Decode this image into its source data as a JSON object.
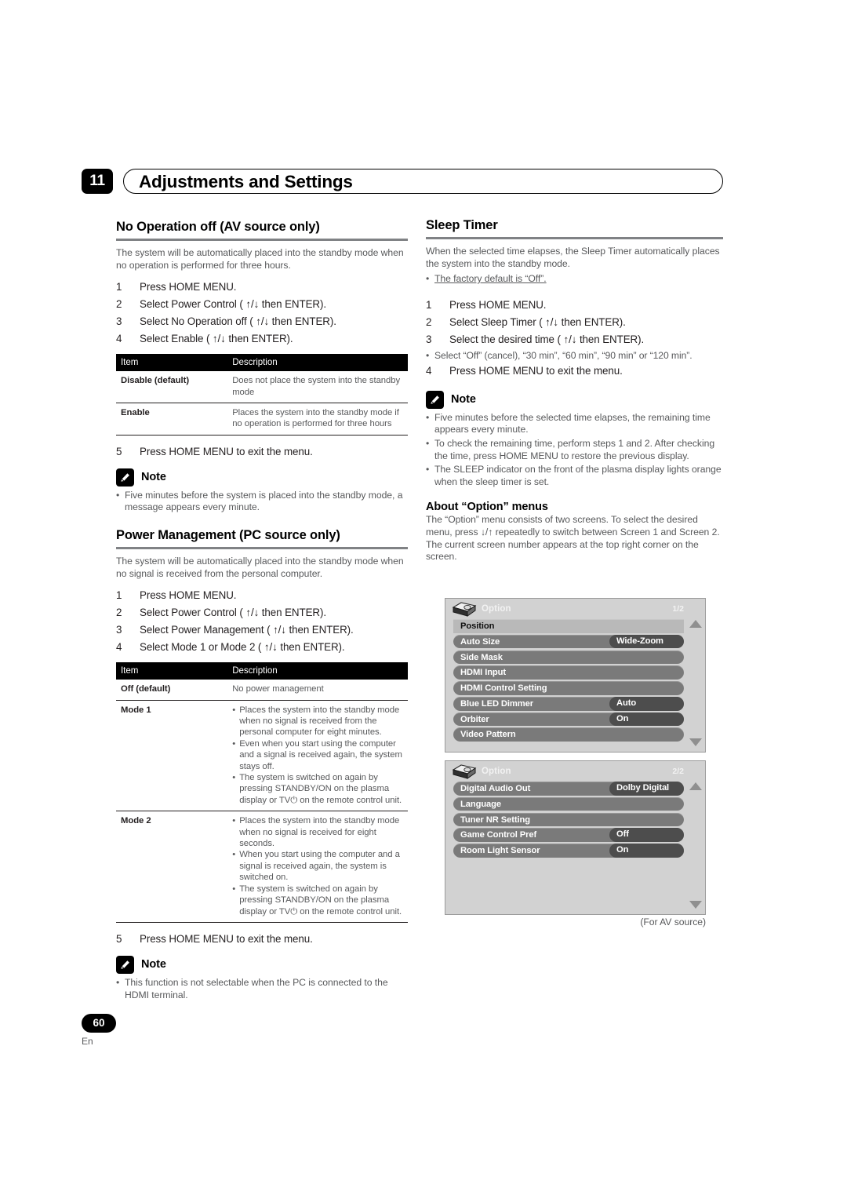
{
  "header": {
    "chapter_number": "11",
    "chapter_title": "Adjustments and Settings"
  },
  "left_column": {
    "section1": {
      "heading": "No Operation off (AV source only)",
      "intro": "The system will be automatically placed into the standby mode when no operation is performed for three hours.",
      "steps": [
        {
          "num": "1",
          "text": "Press HOME MENU."
        },
        {
          "num": "2",
          "text": "Select  Power Control  ( ↑/↓ then ENTER)."
        },
        {
          "num": "3",
          "text": "Select  No Operation off  ( ↑/↓ then ENTER)."
        },
        {
          "num": "4",
          "text": "Select  Enable  ( ↑/↓ then ENTER)."
        }
      ],
      "table": {
        "headers": [
          "Item",
          "Description"
        ],
        "rows": [
          {
            "item": "Disable (default)",
            "desc": "Does not place the system into the standby mode"
          },
          {
            "item": "Enable",
            "desc": "Places the system into the standby mode if no operation is performed for three hours"
          }
        ]
      },
      "final_step": {
        "num": "5",
        "text": "Press HOME MENU to exit the menu."
      },
      "note": {
        "label": "Note",
        "bullets": [
          "Five minutes before the system is placed into the standby mode, a message appears every minute."
        ]
      }
    },
    "section2": {
      "heading": "Power Management (PC source only)",
      "intro": "The system will be automatically placed into the standby mode when no signal is received from the personal computer.",
      "steps": [
        {
          "num": "1",
          "text": "Press HOME MENU."
        },
        {
          "num": "2",
          "text": "Select  Power Control  ( ↑/↓ then ENTER)."
        },
        {
          "num": "3",
          "text": "Select  Power Management  ( ↑/↓ then ENTER)."
        },
        {
          "num": "4",
          "text": "Select  Mode 1  or  Mode 2  ( ↑/↓ then ENTER)."
        }
      ],
      "table": {
        "headers": [
          "Item",
          "Description"
        ],
        "rows": [
          {
            "item": "Off (default)",
            "desc_single": "No power management"
          },
          {
            "item": "Mode 1",
            "desc_bullets": [
              "Places the system into the standby mode when no signal is received from the personal computer for eight minutes.",
              "Even when you start using the computer and a signal is received again, the system stays off.",
              "The system is switched on again by pressing STANDBY/ON on the plasma display or TV⏻ on the remote control unit."
            ]
          },
          {
            "item": "Mode 2",
            "desc_bullets": [
              "Places the system into the standby mode when no signal is received for eight seconds.",
              "When you start using the computer and a signal is received again, the system is switched on.",
              "The system is switched on again by pressing STANDBY/ON on the plasma display or TV⏻ on the remote control unit."
            ]
          }
        ]
      },
      "final_step": {
        "num": "5",
        "text": "Press HOME MENU to exit the menu."
      },
      "note": {
        "label": "Note",
        "bullets": [
          "This function is not selectable when the PC is connected to the HDMI terminal."
        ]
      }
    }
  },
  "right_column": {
    "section1": {
      "heading": "Sleep Timer",
      "intro": "When the selected time elapses, the Sleep Timer automatically places the system into the standby mode.",
      "intro_bullet": "The factory default is “Off”.",
      "steps": [
        {
          "num": "1",
          "text": "Press HOME MENU."
        },
        {
          "num": "2",
          "text": "Select  Sleep Timer  ( ↑/↓ then ENTER)."
        },
        {
          "num": "3",
          "text": "Select the desired time ( ↑/↓ then ENTER)."
        }
      ],
      "step_note": "Select “Off” (cancel), “30 min”, “60 min”, “90 min” or “120 min”.",
      "final_step": {
        "num": "4",
        "text": "Press HOME MENU to exit the menu."
      },
      "note": {
        "label": "Note",
        "bullets": [
          "Five minutes before the selected time elapses, the remaining time appears every minute.",
          "To check the remaining time, perform steps 1 and 2. After checking the time, press HOME MENU to restore the previous display.",
          "The SLEEP indicator on the front of the plasma display lights orange when the sleep timer is set."
        ]
      }
    },
    "section2": {
      "heading": "About “Option” menus",
      "body": "The “Option” menu consists of two screens. To select the desired menu, press ↓/↑ repeatedly to switch between Screen 1 and Screen 2. The current screen number appears at the top right corner on the screen."
    }
  },
  "osd": {
    "screen1": {
      "title": "Option",
      "page_indicator": "1/2",
      "rows": [
        {
          "label": "Position",
          "value": "",
          "selected": true
        },
        {
          "label": "Auto Size",
          "value": "Wide-Zoom",
          "selected": false
        },
        {
          "label": "Side Mask",
          "value": "",
          "selected": false
        },
        {
          "label": "HDMI Input",
          "value": "",
          "selected": false
        },
        {
          "label": "HDMI Control Setting",
          "value": "",
          "selected": false
        },
        {
          "label": "Blue LED Dimmer",
          "value": "Auto",
          "selected": false
        },
        {
          "label": "Orbiter",
          "value": "On",
          "selected": false
        },
        {
          "label": "Video Pattern",
          "value": "",
          "selected": false
        }
      ]
    },
    "screen2": {
      "title": "Option",
      "page_indicator": "2/2",
      "rows": [
        {
          "label": "Digital Audio Out",
          "value": "Dolby Digital",
          "selected": false
        },
        {
          "label": "Language",
          "value": "",
          "selected": false
        },
        {
          "label": "Tuner NR Setting",
          "value": "",
          "selected": false
        },
        {
          "label": "Game Control Pref",
          "value": "Off",
          "selected": false
        },
        {
          "label": "Room Light Sensor",
          "value": "On",
          "selected": false
        }
      ]
    },
    "caption": "(For AV source)"
  },
  "footer": {
    "page_number": "60",
    "language": "En"
  },
  "colors": {
    "rule": "#808285",
    "body_text": "#58595b",
    "heading_text": "#000000",
    "osd_background": "#d2d2d2",
    "osd_row": "#7a7a7a",
    "osd_row_selected": "#b9b9b9",
    "osd_value": "#4d4d4d"
  }
}
